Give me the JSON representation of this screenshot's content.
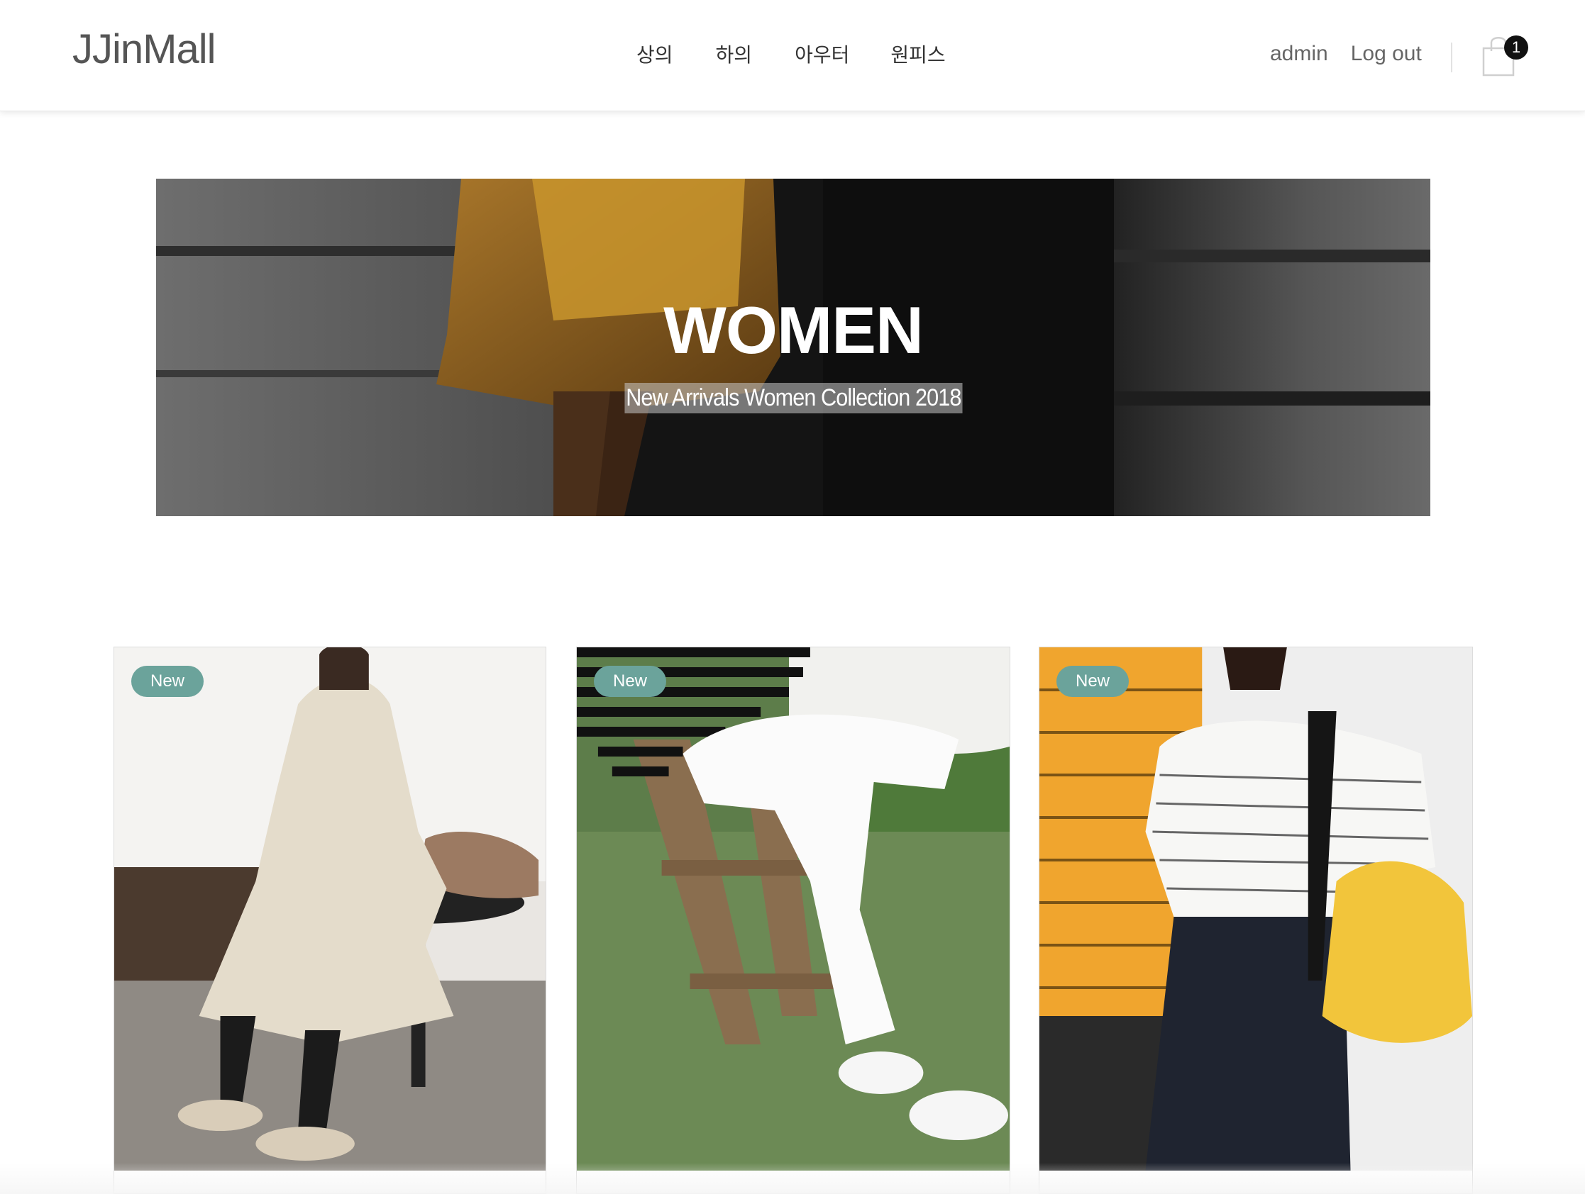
{
  "header": {
    "logo": "JJinMall",
    "nav": [
      {
        "label": "상의"
      },
      {
        "label": "하의"
      },
      {
        "label": "아우터"
      },
      {
        "label": "원피스"
      }
    ],
    "user": {
      "name": "admin",
      "logout_label": "Log out"
    },
    "cart": {
      "icon": "shopping-bag-icon",
      "count": "1"
    }
  },
  "hero": {
    "title": "WOMEN",
    "subtitle": "New Arrivals Women Collection 2018"
  },
  "products": [
    {
      "badge": "New",
      "image": "floral-dress-photo"
    },
    {
      "badge": "New",
      "image": "white-jeans-photo"
    },
    {
      "badge": "New",
      "image": "striped-tee-photo"
    }
  ],
  "colors": {
    "badge": "#6ba39b",
    "text": "#333333",
    "logo": "#555555"
  }
}
